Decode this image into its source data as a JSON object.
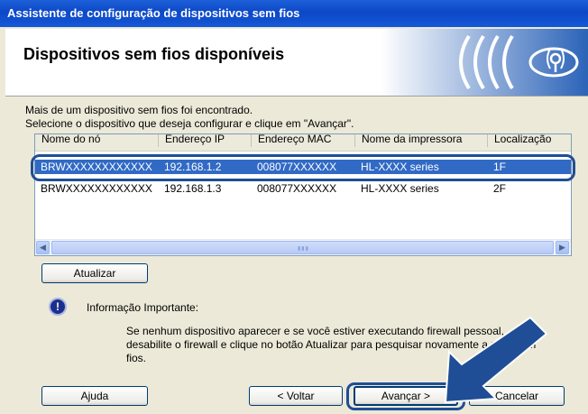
{
  "window": {
    "title": "Assistente de configuração de dispositivos sem fios"
  },
  "header": {
    "title": "Dispositivos sem fios disponíveis"
  },
  "intro": {
    "line1": "Mais de um dispositivo sem fios foi encontrado.",
    "line2": "Selecione o dispositivo que deseja configurar e clique em \"Avançar\"."
  },
  "devices": {
    "columns": [
      "Nome do nó",
      "Endereço IP",
      "Endereço MAC",
      "Nome da impressora",
      "Localização"
    ],
    "rows": [
      {
        "node": "BRWXXXXXXXXXXXX",
        "ip": "192.168.1.2",
        "mac": "008077XXXXXX",
        "printer": "HL-XXXX series",
        "location": "1F",
        "selected": true
      },
      {
        "node": "BRWXXXXXXXXXXXX",
        "ip": "192.168.1.3",
        "mac": "008077XXXXXX",
        "printer": "HL-XXXX series",
        "location": "2F",
        "selected": false
      }
    ]
  },
  "buttons": {
    "refresh": "Atualizar",
    "help": "Ajuda",
    "back": "< Voltar",
    "next": "Avançar >",
    "cancel": "Cancelar"
  },
  "info": {
    "icon": "exclamation-icon",
    "title": "Informação Importante:",
    "text": "Se nenhum dispositivo aparecer e se você estiver executando firewall pessoal, desabilite o firewall e clique no botão Atualizar para pesquisar novamente a rede sem fios."
  },
  "colors": {
    "titlebar": "#0c48c8",
    "selection": "#316ac5",
    "callout": "#1f4e96"
  }
}
